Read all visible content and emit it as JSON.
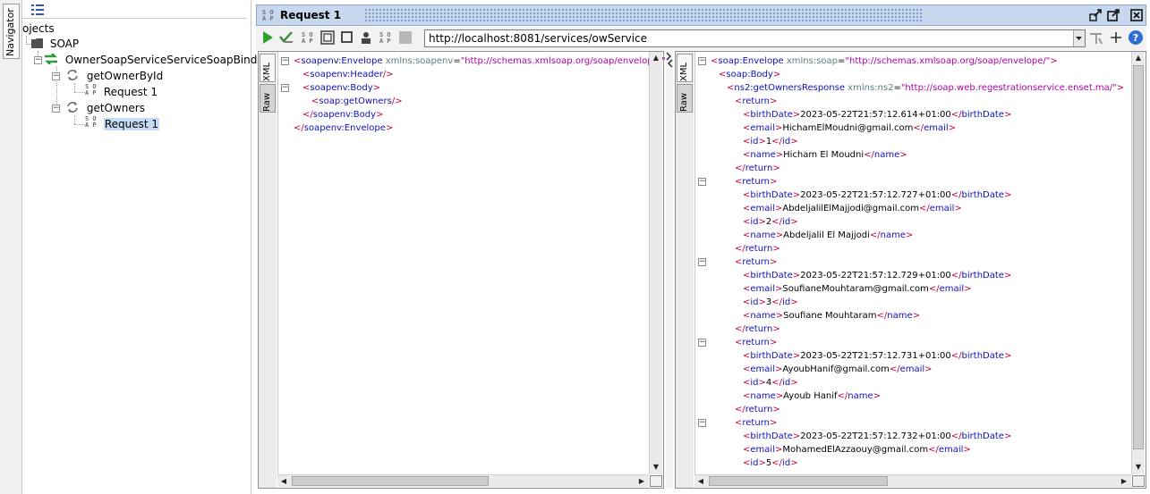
{
  "navigator": {
    "tab_label": "Navigator"
  },
  "tree": {
    "root_label": "ojects",
    "project_label": "SOAP",
    "binding_label": "OwnerSoapServiceServiceSoapBinding",
    "operations": [
      {
        "label": "getOwnerById",
        "request_label": "Request 1"
      },
      {
        "label": "getOwners",
        "request_label": "Request 1"
      }
    ]
  },
  "editor": {
    "title": "Request 1",
    "endpoint_url": "http://localhost:8081/services/owService"
  },
  "request_pane": {
    "tabs": {
      "xml": "XML",
      "raw": "Raw"
    },
    "lines": [
      {
        "indent": 0,
        "fold": "minus",
        "parts": [
          [
            "t",
            "<"
          ],
          [
            "n",
            "soapenv:Envelope"
          ],
          [
            "a",
            " xmlns:soapenv"
          ],
          [
            "tx",
            "="
          ],
          [
            "v",
            "\"http://schemas.xmlsoap.org/soap/envelope/\""
          ]
        ]
      },
      {
        "indent": 1,
        "parts": [
          [
            "t",
            "<"
          ],
          [
            "n",
            "soapenv:Header"
          ],
          [
            "t",
            "/>"
          ]
        ]
      },
      {
        "indent": 1,
        "fold": "minus",
        "parts": [
          [
            "t",
            "<"
          ],
          [
            "n",
            "soapenv:Body"
          ],
          [
            "t",
            ">"
          ]
        ]
      },
      {
        "indent": 2,
        "parts": [
          [
            "t",
            "<"
          ],
          [
            "n",
            "soap:getOwners"
          ],
          [
            "t",
            "/>"
          ]
        ]
      },
      {
        "indent": 1,
        "parts": [
          [
            "t",
            "</"
          ],
          [
            "n",
            "soapenv:Body"
          ],
          [
            "t",
            ">"
          ]
        ]
      },
      {
        "indent": 0,
        "parts": [
          [
            "t",
            "</"
          ],
          [
            "n",
            "soapenv:Envelope"
          ],
          [
            "t",
            ">"
          ]
        ]
      }
    ]
  },
  "response_pane": {
    "tabs": {
      "xml": "XML",
      "raw": "Raw"
    },
    "lines": [
      {
        "indent": 0,
        "fold": "minus",
        "parts": [
          [
            "t",
            "<"
          ],
          [
            "n",
            "soap:Envelope"
          ],
          [
            "a",
            " xmlns:soap"
          ],
          [
            "tx",
            "="
          ],
          [
            "v",
            "\"http://schemas.xmlsoap.org/soap/envelope/\""
          ],
          [
            "t",
            ">"
          ]
        ]
      },
      {
        "indent": 1,
        "parts": [
          [
            "t",
            "<"
          ],
          [
            "n",
            "soap:Body"
          ],
          [
            "t",
            ">"
          ]
        ]
      },
      {
        "indent": 2,
        "parts": [
          [
            "t",
            "<"
          ],
          [
            "n",
            "ns2:getOwnersResponse"
          ],
          [
            "a",
            " xmlns:ns2"
          ],
          [
            "tx",
            "="
          ],
          [
            "v",
            "\"http://soap.web.regestrationservice.enset.ma/\""
          ],
          [
            "t",
            ">"
          ]
        ]
      },
      {
        "indent": 3,
        "parts": [
          [
            "t",
            "<"
          ],
          [
            "n",
            "return"
          ],
          [
            "t",
            ">"
          ]
        ]
      },
      {
        "indent": 4,
        "parts": [
          [
            "t",
            "<"
          ],
          [
            "n",
            "birthDate"
          ],
          [
            "t",
            ">"
          ],
          [
            "tx",
            "2023-05-22T21:57:12.614+01:00"
          ],
          [
            "t",
            "</"
          ],
          [
            "n",
            "birthDate"
          ],
          [
            "t",
            ">"
          ]
        ]
      },
      {
        "indent": 4,
        "parts": [
          [
            "t",
            "<"
          ],
          [
            "n",
            "email"
          ],
          [
            "t",
            ">"
          ],
          [
            "tx",
            "HichamElMoudni@gmail.com"
          ],
          [
            "t",
            "</"
          ],
          [
            "n",
            "email"
          ],
          [
            "t",
            ">"
          ]
        ]
      },
      {
        "indent": 4,
        "parts": [
          [
            "t",
            "<"
          ],
          [
            "n",
            "id"
          ],
          [
            "t",
            ">"
          ],
          [
            "tx",
            "1"
          ],
          [
            "t",
            "</"
          ],
          [
            "n",
            "id"
          ],
          [
            "t",
            ">"
          ]
        ]
      },
      {
        "indent": 4,
        "parts": [
          [
            "t",
            "<"
          ],
          [
            "n",
            "name"
          ],
          [
            "t",
            ">"
          ],
          [
            "tx",
            "Hicham El Moudni"
          ],
          [
            "t",
            "</"
          ],
          [
            "n",
            "name"
          ],
          [
            "t",
            ">"
          ]
        ]
      },
      {
        "indent": 3,
        "parts": [
          [
            "t",
            "</"
          ],
          [
            "n",
            "return"
          ],
          [
            "t",
            ">"
          ]
        ]
      },
      {
        "indent": 3,
        "fold": "minus",
        "parts": [
          [
            "t",
            "<"
          ],
          [
            "n",
            "return"
          ],
          [
            "t",
            ">"
          ]
        ]
      },
      {
        "indent": 4,
        "parts": [
          [
            "t",
            "<"
          ],
          [
            "n",
            "birthDate"
          ],
          [
            "t",
            ">"
          ],
          [
            "tx",
            "2023-05-22T21:57:12.727+01:00"
          ],
          [
            "t",
            "</"
          ],
          [
            "n",
            "birthDate"
          ],
          [
            "t",
            ">"
          ]
        ]
      },
      {
        "indent": 4,
        "parts": [
          [
            "t",
            "<"
          ],
          [
            "n",
            "email"
          ],
          [
            "t",
            ">"
          ],
          [
            "tx",
            "AbdeljalilElMajjodi@gmail.com"
          ],
          [
            "t",
            "</"
          ],
          [
            "n",
            "email"
          ],
          [
            "t",
            ">"
          ]
        ]
      },
      {
        "indent": 4,
        "parts": [
          [
            "t",
            "<"
          ],
          [
            "n",
            "id"
          ],
          [
            "t",
            ">"
          ],
          [
            "tx",
            "2"
          ],
          [
            "t",
            "</"
          ],
          [
            "n",
            "id"
          ],
          [
            "t",
            ">"
          ]
        ]
      },
      {
        "indent": 4,
        "parts": [
          [
            "t",
            "<"
          ],
          [
            "n",
            "name"
          ],
          [
            "t",
            ">"
          ],
          [
            "tx",
            "Abdeljalil El Majjodi"
          ],
          [
            "t",
            "</"
          ],
          [
            "n",
            "name"
          ],
          [
            "t",
            ">"
          ]
        ]
      },
      {
        "indent": 3,
        "parts": [
          [
            "t",
            "</"
          ],
          [
            "n",
            "return"
          ],
          [
            "t",
            ">"
          ]
        ]
      },
      {
        "indent": 3,
        "fold": "minus",
        "parts": [
          [
            "t",
            "<"
          ],
          [
            "n",
            "return"
          ],
          [
            "t",
            ">"
          ]
        ]
      },
      {
        "indent": 4,
        "parts": [
          [
            "t",
            "<"
          ],
          [
            "n",
            "birthDate"
          ],
          [
            "t",
            ">"
          ],
          [
            "tx",
            "2023-05-22T21:57:12.729+01:00"
          ],
          [
            "t",
            "</"
          ],
          [
            "n",
            "birthDate"
          ],
          [
            "t",
            ">"
          ]
        ]
      },
      {
        "indent": 4,
        "parts": [
          [
            "t",
            "<"
          ],
          [
            "n",
            "email"
          ],
          [
            "t",
            ">"
          ],
          [
            "tx",
            "SoufianeMouhtaram@gmail.com"
          ],
          [
            "t",
            "</"
          ],
          [
            "n",
            "email"
          ],
          [
            "t",
            ">"
          ]
        ]
      },
      {
        "indent": 4,
        "parts": [
          [
            "t",
            "<"
          ],
          [
            "n",
            "id"
          ],
          [
            "t",
            ">"
          ],
          [
            "tx",
            "3"
          ],
          [
            "t",
            "</"
          ],
          [
            "n",
            "id"
          ],
          [
            "t",
            ">"
          ]
        ]
      },
      {
        "indent": 4,
        "parts": [
          [
            "t",
            "<"
          ],
          [
            "n",
            "name"
          ],
          [
            "t",
            ">"
          ],
          [
            "tx",
            "Soufiane Mouhtaram"
          ],
          [
            "t",
            "</"
          ],
          [
            "n",
            "name"
          ],
          [
            "t",
            ">"
          ]
        ]
      },
      {
        "indent": 3,
        "parts": [
          [
            "t",
            "</"
          ],
          [
            "n",
            "return"
          ],
          [
            "t",
            ">"
          ]
        ]
      },
      {
        "indent": 3,
        "fold": "minus",
        "parts": [
          [
            "t",
            "<"
          ],
          [
            "n",
            "return"
          ],
          [
            "t",
            ">"
          ]
        ]
      },
      {
        "indent": 4,
        "parts": [
          [
            "t",
            "<"
          ],
          [
            "n",
            "birthDate"
          ],
          [
            "t",
            ">"
          ],
          [
            "tx",
            "2023-05-22T21:57:12.731+01:00"
          ],
          [
            "t",
            "</"
          ],
          [
            "n",
            "birthDate"
          ],
          [
            "t",
            ">"
          ]
        ]
      },
      {
        "indent": 4,
        "parts": [
          [
            "t",
            "<"
          ],
          [
            "n",
            "email"
          ],
          [
            "t",
            ">"
          ],
          [
            "tx",
            "AyoubHanif@gmail.com"
          ],
          [
            "t",
            "</"
          ],
          [
            "n",
            "email"
          ],
          [
            "t",
            ">"
          ]
        ]
      },
      {
        "indent": 4,
        "parts": [
          [
            "t",
            "<"
          ],
          [
            "n",
            "id"
          ],
          [
            "t",
            ">"
          ],
          [
            "tx",
            "4"
          ],
          [
            "t",
            "</"
          ],
          [
            "n",
            "id"
          ],
          [
            "t",
            ">"
          ]
        ]
      },
      {
        "indent": 4,
        "parts": [
          [
            "t",
            "<"
          ],
          [
            "n",
            "name"
          ],
          [
            "t",
            ">"
          ],
          [
            "tx",
            "Ayoub Hanif"
          ],
          [
            "t",
            "</"
          ],
          [
            "n",
            "name"
          ],
          [
            "t",
            ">"
          ]
        ]
      },
      {
        "indent": 3,
        "parts": [
          [
            "t",
            "</"
          ],
          [
            "n",
            "return"
          ],
          [
            "t",
            ">"
          ]
        ]
      },
      {
        "indent": 3,
        "fold": "minus",
        "parts": [
          [
            "t",
            "<"
          ],
          [
            "n",
            "return"
          ],
          [
            "t",
            ">"
          ]
        ]
      },
      {
        "indent": 4,
        "parts": [
          [
            "t",
            "<"
          ],
          [
            "n",
            "birthDate"
          ],
          [
            "t",
            ">"
          ],
          [
            "tx",
            "2023-05-22T21:57:12.732+01:00"
          ],
          [
            "t",
            "</"
          ],
          [
            "n",
            "birthDate"
          ],
          [
            "t",
            ">"
          ]
        ]
      },
      {
        "indent": 4,
        "parts": [
          [
            "t",
            "<"
          ],
          [
            "n",
            "email"
          ],
          [
            "t",
            ">"
          ],
          [
            "tx",
            "MohamedElAzzaouy@gmail.com"
          ],
          [
            "t",
            "</"
          ],
          [
            "n",
            "email"
          ],
          [
            "t",
            ">"
          ]
        ]
      },
      {
        "indent": 4,
        "parts": [
          [
            "t",
            "<"
          ],
          [
            "n",
            "id"
          ],
          [
            "t",
            ">"
          ],
          [
            "tx",
            "5"
          ],
          [
            "t",
            "</"
          ],
          [
            "n",
            "id"
          ],
          [
            "t",
            ">"
          ]
        ]
      }
    ]
  },
  "colors": {
    "tag_bracket": "#c1003b",
    "tag_name": "#1010b8",
    "attribute": "#5a7f7f",
    "attr_value": "#b000a8",
    "selection": "#c5dcf5",
    "title_bar": "#c6d7ee"
  },
  "icons": {
    "toolbar": [
      "run-icon",
      "validate-icon",
      "soap-icon",
      "grid-icon",
      "stop-icon",
      "user-icon",
      "soap-icon",
      "disabled-icon"
    ],
    "title_actions": [
      "detach-icon",
      "maximize-icon",
      "close-icon"
    ],
    "url_actions": [
      "dropdown-icon",
      "filter-icon",
      "add-icon",
      "help-icon"
    ]
  }
}
